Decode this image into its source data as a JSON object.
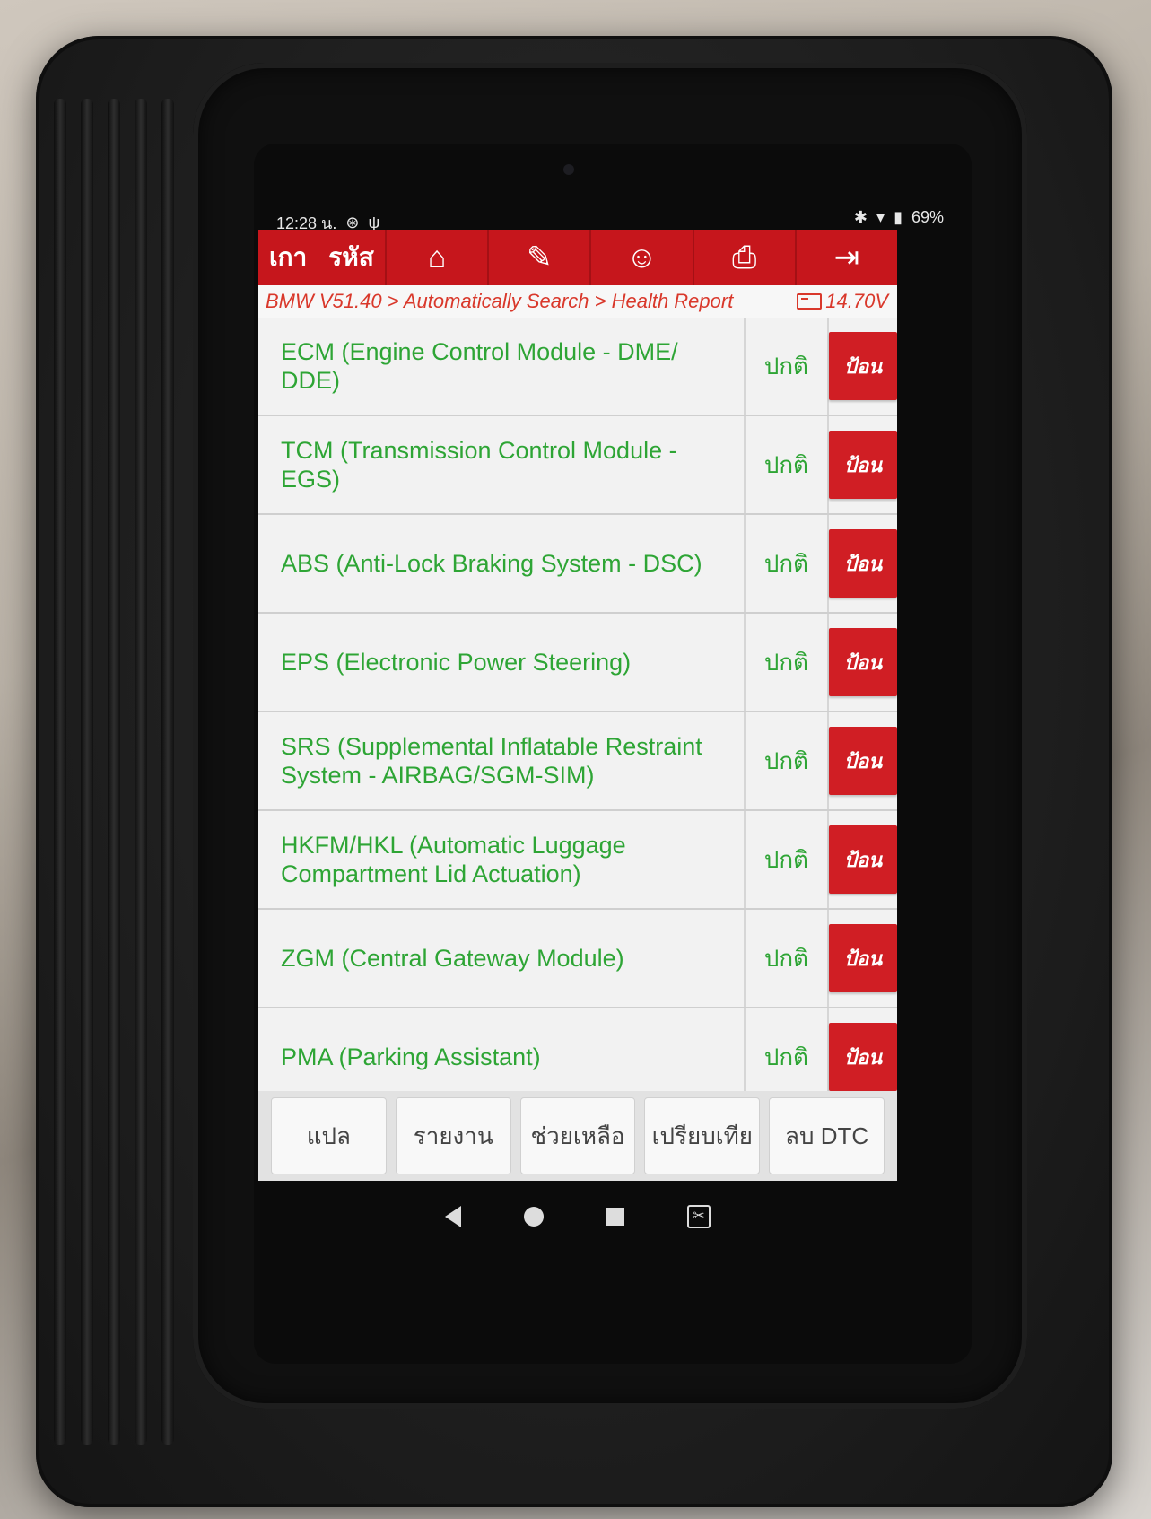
{
  "status_bar": {
    "time": "12:28 น.",
    "battery": "69%"
  },
  "toolbar": {
    "left_label_1": "เกา",
    "left_label_2": "รหัส",
    "icons": [
      "home-icon",
      "edit-icon",
      "support-icon",
      "print-icon",
      "exit-icon"
    ]
  },
  "breadcrumb": {
    "path": "BMW V51.40 > Automatically Search > Health Report",
    "voltage": "14.70V"
  },
  "rows": [
    {
      "name": "ECM (Engine Control Module - DME/ DDE)",
      "status": "ปกติ",
      "action": "ป้อน"
    },
    {
      "name": "TCM (Transmission Control Module - EGS)",
      "status": "ปกติ",
      "action": "ป้อน"
    },
    {
      "name": "ABS (Anti-Lock Braking System - DSC)",
      "status": "ปกติ",
      "action": "ป้อน"
    },
    {
      "name": "EPS (Electronic Power Steering)",
      "status": "ปกติ",
      "action": "ป้อน"
    },
    {
      "name": "SRS (Supplemental Inflatable Restraint System - AIRBAG/SGM-SIM)",
      "status": "ปกติ",
      "action": "ป้อน"
    },
    {
      "name": "HKFM/HKL (Automatic Luggage Compartment Lid Actuation)",
      "status": "ปกติ",
      "action": "ป้อน"
    },
    {
      "name": "ZGM (Central Gateway Module)",
      "status": "ปกติ",
      "action": "ป้อน"
    },
    {
      "name": "PMA (Parking Assistant)",
      "status": "ปกติ",
      "action": "ป้อน"
    }
  ],
  "bottom_buttons": [
    "แปล",
    "รายงาน",
    "ช่วยเหลือ",
    "เปรียบเทีย",
    "ลบ DTC"
  ],
  "colors": {
    "toolbar": "#c6161c",
    "accent_text": "#2ea535",
    "breadcrumb_text": "#d9382b",
    "action_button": "#d01e24"
  }
}
